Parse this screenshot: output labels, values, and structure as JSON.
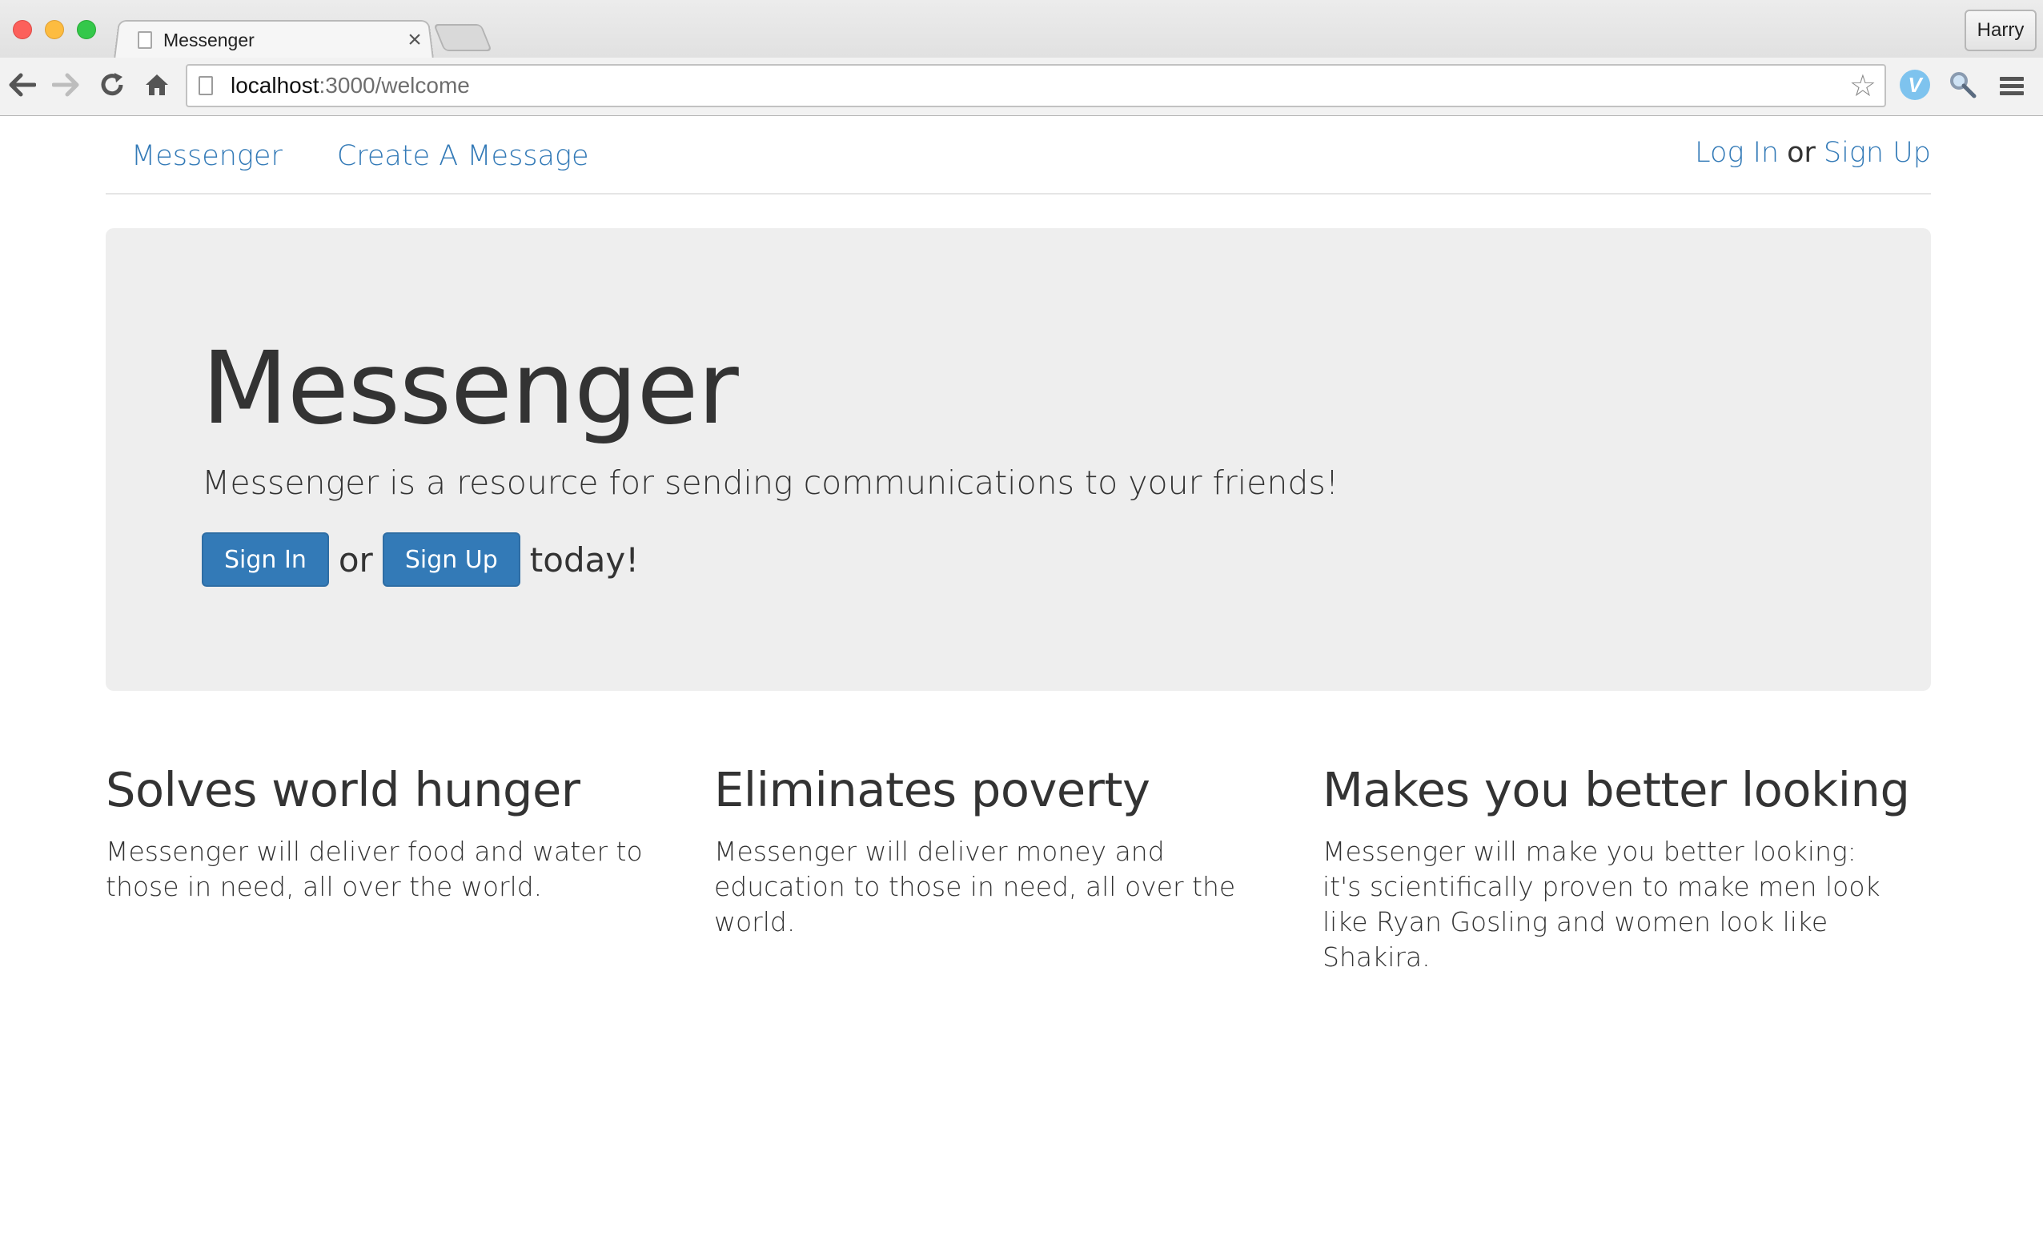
{
  "browser": {
    "tab_title": "Messenger",
    "tab_close": "×",
    "profile_name": "Harry",
    "url_host": "localhost",
    "url_rest": ":3000/welcome"
  },
  "nav": {
    "brand": "Messenger",
    "create_link": "Create A Message",
    "login_link": "Log In",
    "or_text": "or",
    "signup_link": "Sign Up"
  },
  "hero": {
    "title": "Messenger",
    "lead": "Messenger is a resource for sending communications to your friends!",
    "sign_in_button": "Sign In",
    "or_text": "or",
    "sign_up_button": "Sign Up",
    "suffix": "today!"
  },
  "features": [
    {
      "heading": "Solves world hunger",
      "body": "Messenger will deliver food and water to those in need, all over the world."
    },
    {
      "heading": "Eliminates poverty",
      "body": "Messenger will deliver money and education to those in need, all over the world."
    },
    {
      "heading": "Makes you better looking",
      "body": "Messenger will make you better looking: it's scientifically proven to make men look like Ryan Gosling and women look like Shakira."
    }
  ],
  "colors": {
    "link": "#337ab7",
    "button": "#337ab7",
    "jumbotron_bg": "#eeeeee"
  }
}
